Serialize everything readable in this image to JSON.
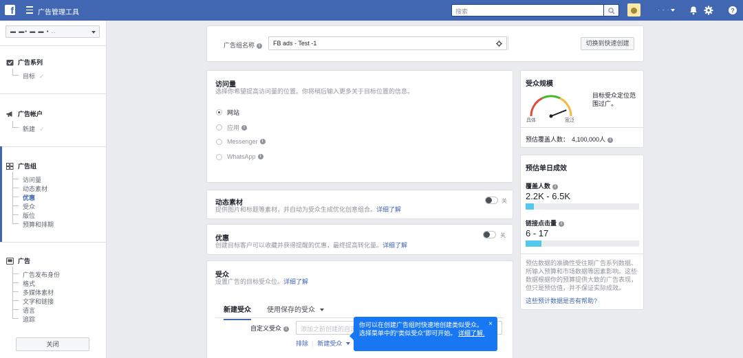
{
  "topbar": {
    "logo_letter": "f",
    "app_title": "广告管理工具",
    "search_placeholder": "搜索",
    "account_name": "· - ·",
    "icons": [
      "facebook-logo-icon",
      "menu-icon",
      "search-icon",
      "bell-icon",
      "gear-icon",
      "help-icon"
    ]
  },
  "sidebar": {
    "account_selector": "▬ ▬▪ ▬ ▬ ▪ ..",
    "sections": [
      {
        "title": "广告系列",
        "icon": "campaign-icon",
        "items": [
          {
            "label": "目标",
            "done": "✓"
          }
        ]
      },
      {
        "title": "广告帐户",
        "icon": "megaphone-icon",
        "items": [
          {
            "label": "新建",
            "done": "✓"
          }
        ]
      },
      {
        "title": "广告组",
        "icon": "grid-icon",
        "items": [
          {
            "label": "访问量"
          },
          {
            "label": "动态素材"
          },
          {
            "label": "优惠",
            "active": true
          },
          {
            "label": "受众"
          },
          {
            "label": "版位"
          },
          {
            "label": "预算和排期"
          }
        ]
      },
      {
        "title": "广告",
        "icon": "ad-icon",
        "items": [
          {
            "label": "广告发布身份"
          },
          {
            "label": "格式"
          },
          {
            "label": "多媒体素材"
          },
          {
            "label": "文字和链接"
          },
          {
            "label": "语言"
          },
          {
            "label": "追踪"
          }
        ]
      }
    ],
    "close_label": "关闭"
  },
  "adset_name": {
    "label": "广告组名称",
    "value": "FB ads - Test -1",
    "quick_create_label": "切换到快速创建"
  },
  "traffic": {
    "title": "访问量",
    "description": "选择你希望提高访问量的位置。你将稍后输入更多关于目标位置的信息。",
    "options": [
      {
        "label": "网站",
        "selected": true,
        "info": false
      },
      {
        "label": "应用",
        "selected": false,
        "info": true
      },
      {
        "label": "Messenger",
        "selected": false,
        "info": true
      },
      {
        "label": "WhatsApp",
        "selected": false,
        "info": true
      }
    ]
  },
  "dynamic_creative": {
    "title": "动态素材",
    "description": "提供图片和标题等素材，并自动为受众生成优化创意组合。",
    "learn_more": "详细了解",
    "toggle_label": "关"
  },
  "offer": {
    "title": "优惠",
    "description": "创建目标客户可以收藏并获得提醒的优惠，最终提高转化量。",
    "learn_more": "详细了解",
    "toggle_label": "关"
  },
  "audience": {
    "title": "受众",
    "description": "设置广告的目标受众位。",
    "learn_more": "详细了解",
    "tabs": [
      "新建受众",
      "使用保存的受众"
    ],
    "custom_audience_label": "自定义受众",
    "custom_audience_placeholder": "添加之前创建的自定",
    "exclude_label": "排除",
    "new_audience_label": "新建受众"
  },
  "tooltip": {
    "text": "你可以在创建广告组时快速地创建类似受众。选择菜单中的\"类似受众\"即可开始。",
    "link": "详细了解.",
    "close": "×"
  },
  "audience_size": {
    "title": "受众规模",
    "note": "目标受众定位范围过广。",
    "gauge_left": "具体",
    "gauge_right": "宽泛",
    "gauge_level": 0.88,
    "reach_label": "预估覆盖人数：",
    "reach_value": "4,100,000人"
  },
  "daily_results": {
    "title": "预估单日成效",
    "metrics": [
      {
        "label": "覆盖人数",
        "value": "2.2K - 6.5K",
        "fill": 0.07
      },
      {
        "label": "链接点击量",
        "value": "6 - 17",
        "fill": 0.14
      }
    ],
    "disclaimer": "预估数据的准确性受往期广告系列数据、所输入预算和市场数据等因素影响。这些数据根据你的预算提供大致的广告表现，但只是预估值，并不保证实际成效。",
    "help_link": "这些预计数据是否有帮助?"
  },
  "colors": {
    "brand": "#4267b2",
    "tooltip": "#1877f2",
    "bar": "#54c7ec",
    "gauge_red": "#e4483a",
    "gauge_yellow": "#f6b93d",
    "gauge_green": "#42b72a"
  }
}
